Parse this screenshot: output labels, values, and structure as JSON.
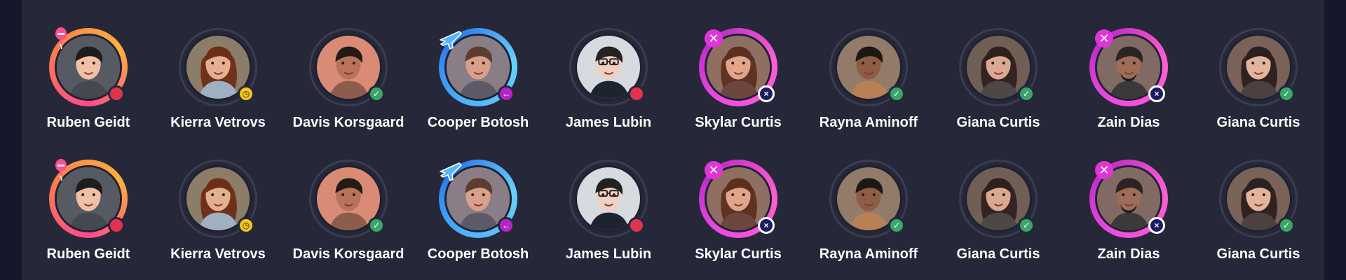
{
  "colors": {
    "background": "#15172a",
    "panel": "#262839",
    "text": "#ffffff",
    "status_red": "#e1334e",
    "status_yellow": "#f6c61b",
    "status_green": "#39a66a",
    "status_purple": "#b625c7",
    "status_navy": "#1b1b66",
    "ring_pink": "#ff4a8b",
    "ring_blue": "#4db3ff",
    "ring_purple": "#f04de0"
  },
  "rows": [
    {
      "people": [
        {
          "name": "Ruben Geidt",
          "ring": "gradient-pink",
          "status": "red",
          "top_badge": "balloon-icon",
          "status_icon": ""
        },
        {
          "name": "Kierra Vetrovs",
          "ring": "neutral",
          "status": "yellow",
          "top_badge": "",
          "status_icon": "clock-icon"
        },
        {
          "name": "Davis Korsgaard",
          "ring": "neutral",
          "status": "green",
          "top_badge": "",
          "status_icon": "check-icon"
        },
        {
          "name": "Cooper Botosh",
          "ring": "gradient-blue",
          "status": "purple",
          "top_badge": "plane-icon",
          "status_icon": "arrow-left-icon"
        },
        {
          "name": "James Lubin",
          "ring": "neutral",
          "status": "red",
          "top_badge": "",
          "status_icon": ""
        },
        {
          "name": "Skylar Curtis",
          "ring": "gradient-purple",
          "status": "navy",
          "top_badge": "close-icon",
          "status_icon": "x-icon"
        },
        {
          "name": "Rayna Aminoff",
          "ring": "neutral",
          "status": "green",
          "top_badge": "",
          "status_icon": "check-icon"
        },
        {
          "name": "Giana Curtis",
          "ring": "neutral",
          "status": "green",
          "top_badge": "",
          "status_icon": "check-icon"
        },
        {
          "name": "Zain Dias",
          "ring": "gradient-purple",
          "status": "navy",
          "top_badge": "close-icon",
          "status_icon": "x-icon"
        },
        {
          "name": "Giana Curtis",
          "ring": "neutral",
          "status": "green",
          "top_badge": "",
          "status_icon": "check-icon"
        }
      ]
    },
    {
      "people": [
        {
          "name": "Ruben Geidt",
          "ring": "gradient-pink",
          "status": "red",
          "top_badge": "balloon-icon",
          "status_icon": ""
        },
        {
          "name": "Kierra Vetrovs",
          "ring": "neutral",
          "status": "yellow",
          "top_badge": "",
          "status_icon": "clock-icon"
        },
        {
          "name": "Davis Korsgaard",
          "ring": "neutral",
          "status": "green",
          "top_badge": "",
          "status_icon": "check-icon"
        },
        {
          "name": "Cooper Botosh",
          "ring": "gradient-blue",
          "status": "purple",
          "top_badge": "plane-icon",
          "status_icon": "arrow-left-icon"
        },
        {
          "name": "James Lubin",
          "ring": "neutral",
          "status": "red",
          "top_badge": "",
          "status_icon": ""
        },
        {
          "name": "Skylar Curtis",
          "ring": "gradient-purple",
          "status": "navy",
          "top_badge": "close-icon",
          "status_icon": "x-icon"
        },
        {
          "name": "Rayna Aminoff",
          "ring": "neutral",
          "status": "green",
          "top_badge": "",
          "status_icon": "check-icon"
        },
        {
          "name": "Giana Curtis",
          "ring": "neutral",
          "status": "green",
          "top_badge": "",
          "status_icon": "check-icon"
        },
        {
          "name": "Zain Dias",
          "ring": "gradient-purple",
          "status": "navy",
          "top_badge": "close-icon",
          "status_icon": "x-icon"
        },
        {
          "name": "Giana Curtis",
          "ring": "neutral",
          "status": "green",
          "top_badge": "",
          "status_icon": "check-icon"
        }
      ]
    }
  ]
}
